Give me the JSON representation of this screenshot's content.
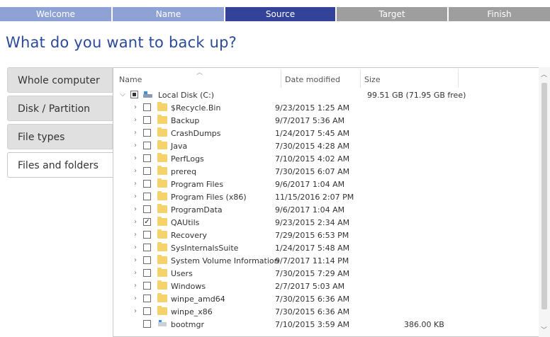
{
  "steps": [
    "Welcome",
    "Name",
    "Source",
    "Target",
    "Finish"
  ],
  "title": "What do you want to back up?",
  "tabs": [
    "Whole computer",
    "Disk / Partition",
    "File types",
    "Files and folders"
  ],
  "columns": {
    "name": "Name",
    "date": "Date modified",
    "size": "Size"
  },
  "drive": {
    "name": "Local Disk (C:)",
    "size": "99.51 GB (71.95 GB free)"
  },
  "items": [
    {
      "name": "$Recycle.Bin",
      "date": "9/23/2015 1:25 AM",
      "checked": false
    },
    {
      "name": "Backup",
      "date": "9/7/2017 5:36 AM",
      "checked": false
    },
    {
      "name": "CrashDumps",
      "date": "1/24/2017 5:45 AM",
      "checked": false
    },
    {
      "name": "Java",
      "date": "7/30/2015 4:28 AM",
      "checked": false
    },
    {
      "name": "PerfLogs",
      "date": "7/10/2015 4:02 AM",
      "checked": false
    },
    {
      "name": "prereq",
      "date": "7/30/2015 6:07 AM",
      "checked": false
    },
    {
      "name": "Program Files",
      "date": "9/6/2017 1:04 AM",
      "checked": false
    },
    {
      "name": "Program Files (x86)",
      "date": "11/15/2016 2:07 PM",
      "checked": false
    },
    {
      "name": "ProgramData",
      "date": "9/6/2017 1:04 AM",
      "checked": false
    },
    {
      "name": "QAUtils",
      "date": "9/23/2015 2:34 AM",
      "checked": true
    },
    {
      "name": "Recovery",
      "date": "7/29/2015 6:53 PM",
      "checked": false
    },
    {
      "name": "SysInternalsSuite",
      "date": "1/24/2017 5:48 AM",
      "checked": false
    },
    {
      "name": "System Volume Information",
      "date": "9/7/2017 11:14 PM",
      "checked": false
    },
    {
      "name": "Users",
      "date": "7/30/2015 7:29 AM",
      "checked": false
    },
    {
      "name": "Windows",
      "date": "2/7/2017 5:03 AM",
      "checked": false
    },
    {
      "name": "winpe_amd64",
      "date": "7/30/2015 6:36 AM",
      "checked": false
    },
    {
      "name": "winpe_x86",
      "date": "7/30/2015 6:36 AM",
      "checked": false
    }
  ],
  "files": [
    {
      "name": "bootmgr",
      "date": "7/10/2015 3:59 AM",
      "size": "386.00 KB"
    }
  ],
  "icons": {
    "expand": "chevron-right-icon",
    "collapse": "chevron-down-icon",
    "folder": "folder-icon",
    "drive": "drive-icon",
    "file": "file-icon"
  }
}
